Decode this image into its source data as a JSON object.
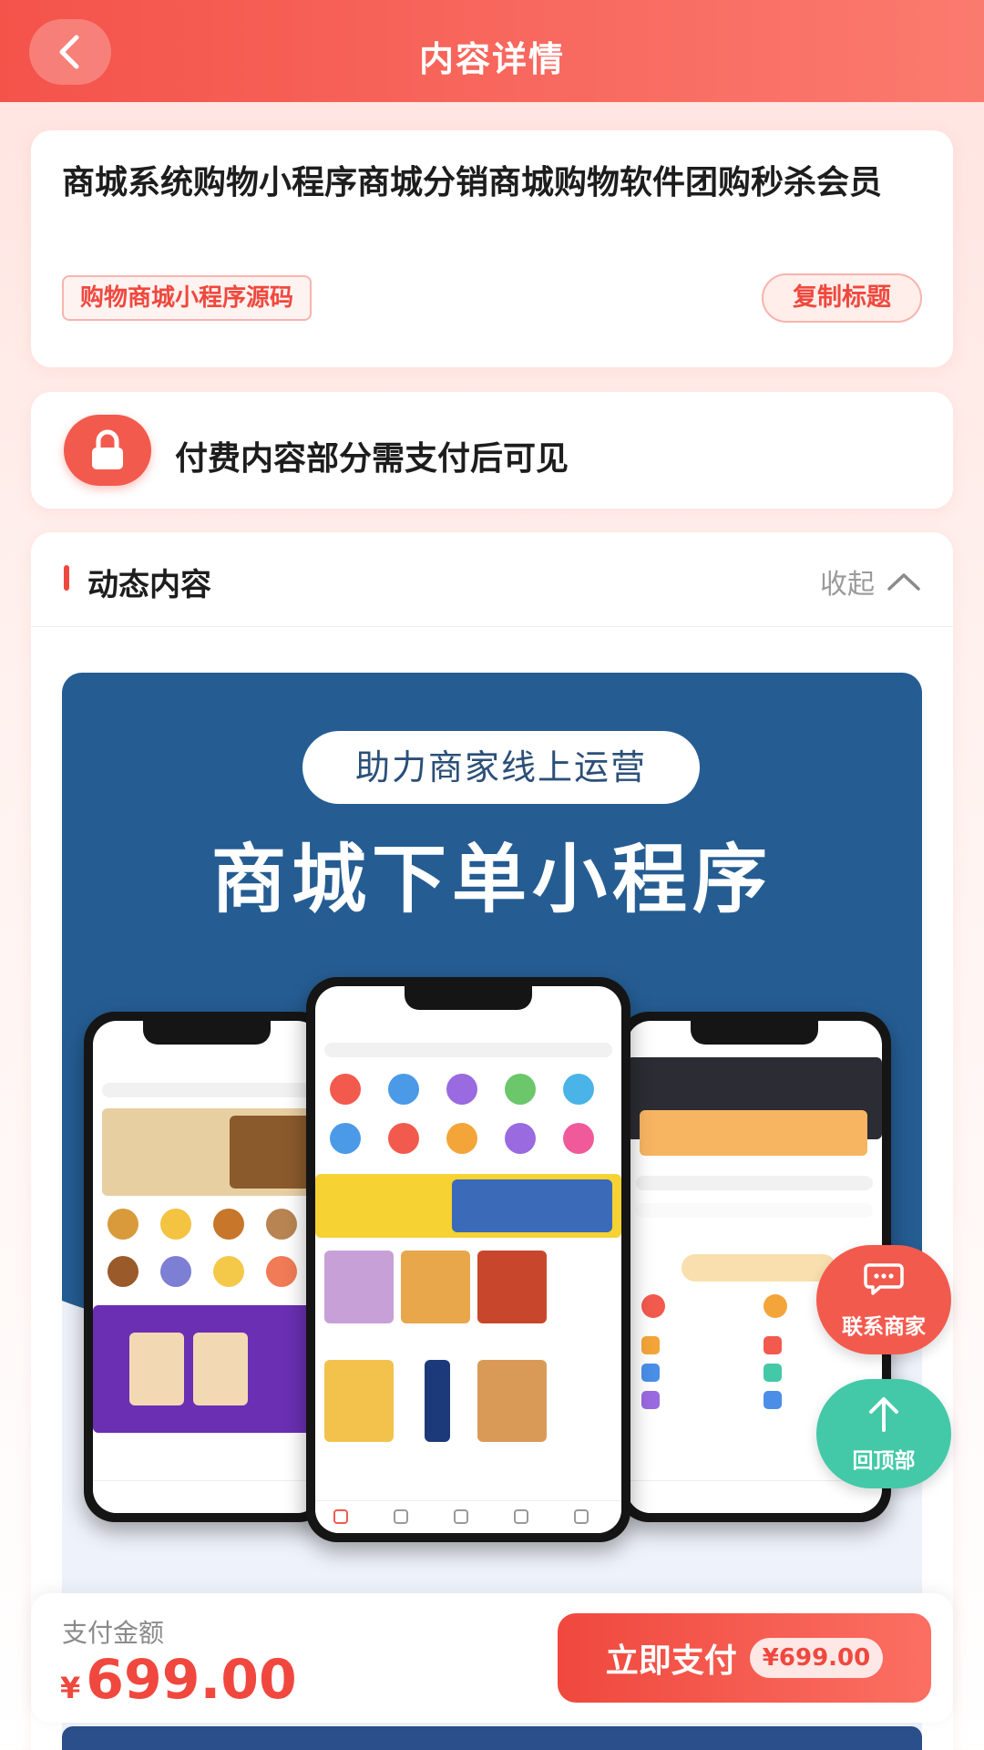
{
  "header": {
    "title": "内容详情"
  },
  "product": {
    "title": "商城系统购物小程序商城分销商城购物软件团购秒杀会员",
    "tag": "购物商城小程序源码",
    "copy_label": "复制标题"
  },
  "lock": {
    "text": "付费内容部分需支付后可见"
  },
  "dynamic": {
    "title": "动态内容",
    "collapse_label": "收起"
  },
  "banner": {
    "pill": "助力商家线上运营",
    "headline": "商城下单小程序"
  },
  "floating": {
    "contact_label": "联系商家",
    "top_label": "回顶部"
  },
  "pay": {
    "label": "支付金额",
    "currency": "¥",
    "amount": "699.00",
    "button_label": "立即支付",
    "button_price": "¥699.00"
  },
  "colors": {
    "accent": "#f0483e",
    "header_start": "#f4534a",
    "header_end": "#fb7a6f",
    "banner_blue": "#255d93",
    "top_button": "#43c9a8"
  }
}
